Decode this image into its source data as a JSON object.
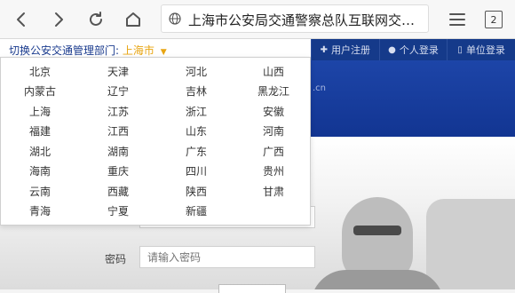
{
  "browser": {
    "url_text": "上海市公安局交通警察总队互联网交…",
    "tab_count": "2"
  },
  "topbar": {
    "dept_prefix": "切换公安交通管理部门:",
    "dept_city": "上海市",
    "links": [
      {
        "icon": "plus-icon",
        "label": "用户注册"
      },
      {
        "icon": "person-icon",
        "label": "个人登录"
      },
      {
        "icon": "building-icon",
        "label": "单位登录"
      }
    ]
  },
  "banner": {
    "site_fragment": ".cn"
  },
  "login": {
    "password_label": "密码",
    "password_placeholder": "请输入密码"
  },
  "provinces": [
    "北京",
    "天津",
    "河北",
    "山西",
    "内蒙古",
    "辽宁",
    "吉林",
    "黑龙江",
    "上海",
    "江苏",
    "浙江",
    "安徽",
    "福建",
    "江西",
    "山东",
    "河南",
    "湖北",
    "湖南",
    "广东",
    "广西",
    "海南",
    "重庆",
    "四川",
    "贵州",
    "云南",
    "西藏",
    "陕西",
    "甘肃",
    "青海",
    "宁夏",
    "新疆"
  ],
  "colors": {
    "accent_blue": "#153a8a",
    "city_highlight": "#e8a512"
  }
}
